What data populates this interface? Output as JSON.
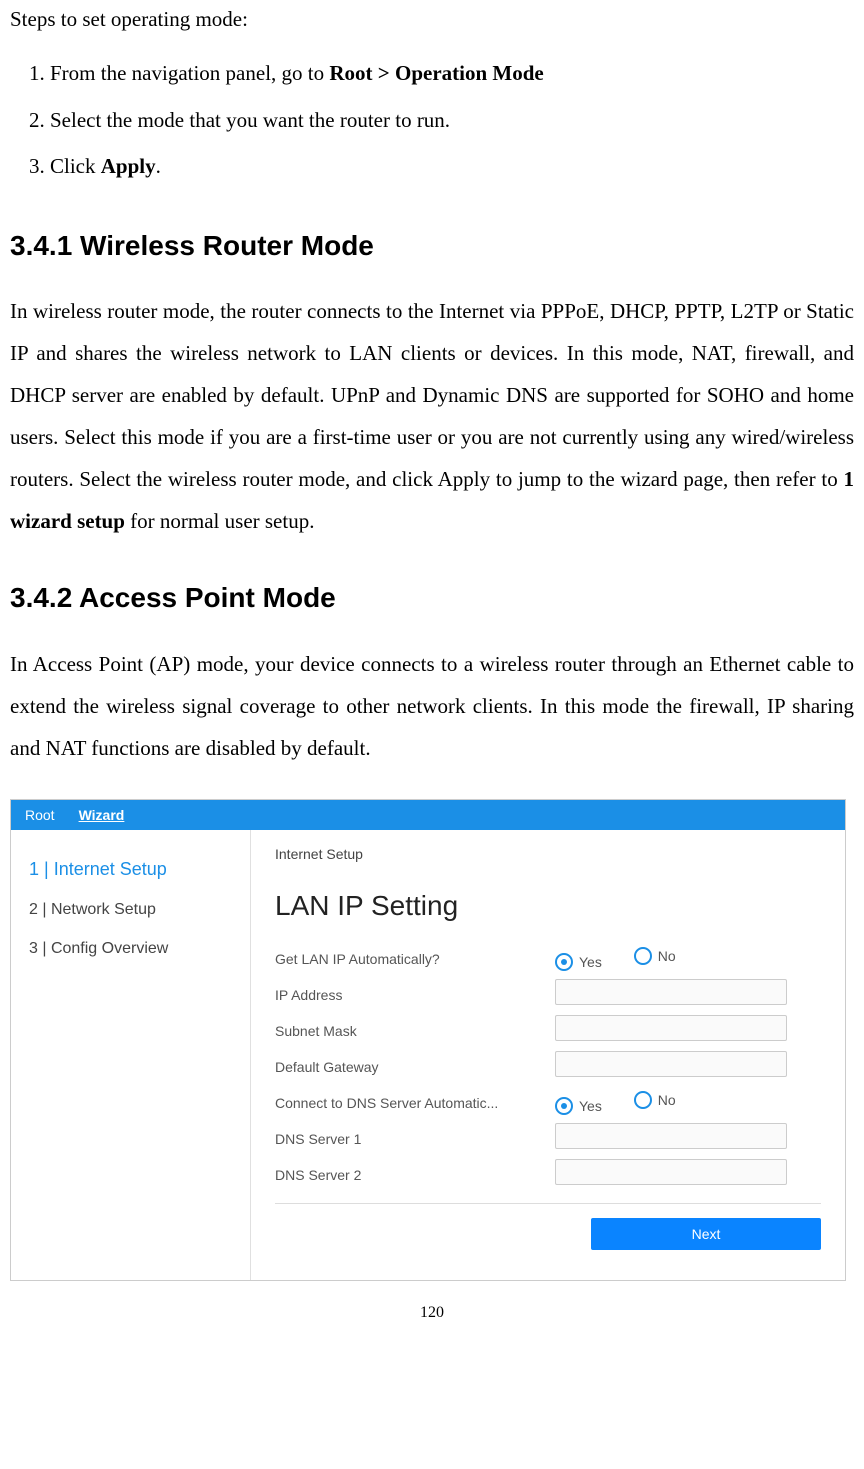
{
  "intro": "Steps to set operating mode:",
  "steps": [
    {
      "pre": "From the navigation panel, go to ",
      "bold": "Root > Operation Mode",
      "post": ""
    },
    {
      "pre": "Select the mode that you want the router to run.",
      "bold": "",
      "post": ""
    },
    {
      "pre": "Click ",
      "bold": "Apply",
      "post": "."
    }
  ],
  "h_341": "3.4.1 Wireless Router Mode",
  "p_341_a": "In wireless router mode, the router connects to the Internet via PPPoE, DHCP, PPTP, L2TP or Static IP and shares the wireless network to LAN clients or devices. In this mode, NAT, firewall, and DHCP server are enabled by default. UPnP and Dynamic DNS are supported for SOHO and home users. Select this mode if you are a first-time user or you are not currently using any wired/wireless routers. Select the wireless router mode, and click Apply to jump to the wizard page, then refer to ",
  "p_341_bold": "1 wizard setup",
  "p_341_b": " for normal user setup.",
  "h_342": "3.4.2 Access Point Mode",
  "p_342": "In Access Point (AP) mode, your device connects to a wireless router through an Ethernet cable to extend the wireless signal coverage to other network clients. In this mode the firewall, IP sharing and NAT functions are disabled by default.",
  "fig": {
    "crumb_root": "Root",
    "crumb_wizard": "Wizard",
    "side": {
      "s1": "1 | Internet Setup",
      "s2": "2 | Network Setup",
      "s3": "3 | Config Overview"
    },
    "tab": "Internet Setup",
    "panel_title": "LAN IP Setting",
    "rows": {
      "r1": "Get LAN IP Automatically?",
      "r2": "IP Address",
      "r3": "Subnet Mask",
      "r4": "Default Gateway",
      "r5": "Connect to DNS Server Automatic...",
      "r6": "DNS Server 1",
      "r7": "DNS Server 2"
    },
    "yes": "Yes",
    "no": "No",
    "next": "Next"
  },
  "page_number": "120"
}
